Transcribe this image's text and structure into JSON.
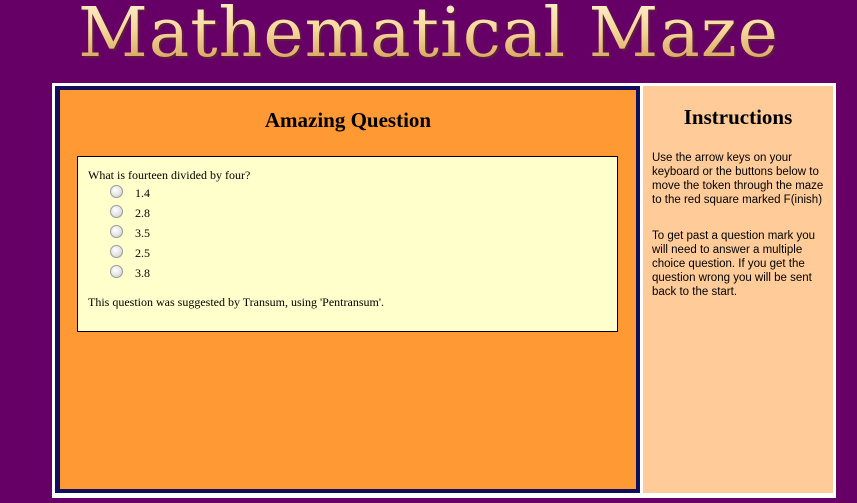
{
  "header": {
    "title": "Mathematical Maze"
  },
  "question_panel": {
    "heading": "Amazing Question",
    "question": "What is fourteen divided by four?",
    "options": [
      "1.4",
      "2.8",
      "3.5",
      "2.5",
      "3.8"
    ],
    "credit": "This question was suggested by Transum, using 'Pentransum'."
  },
  "instructions": {
    "title": "Instructions",
    "paragraphs": [
      "Use the arrow keys on your keyboard or the buttons below to move the token through the maze to the red square marked F(inish)",
      "To get past a question mark you will need to answer a multiple choice question. If you get the question wrong you will be sent back to the start."
    ]
  },
  "colors": {
    "page_background": "#660066",
    "question_area": "#ff9933",
    "question_box": "#ffffcc",
    "instructions_area": "#ffcc99",
    "border": "#0f0f5e"
  }
}
